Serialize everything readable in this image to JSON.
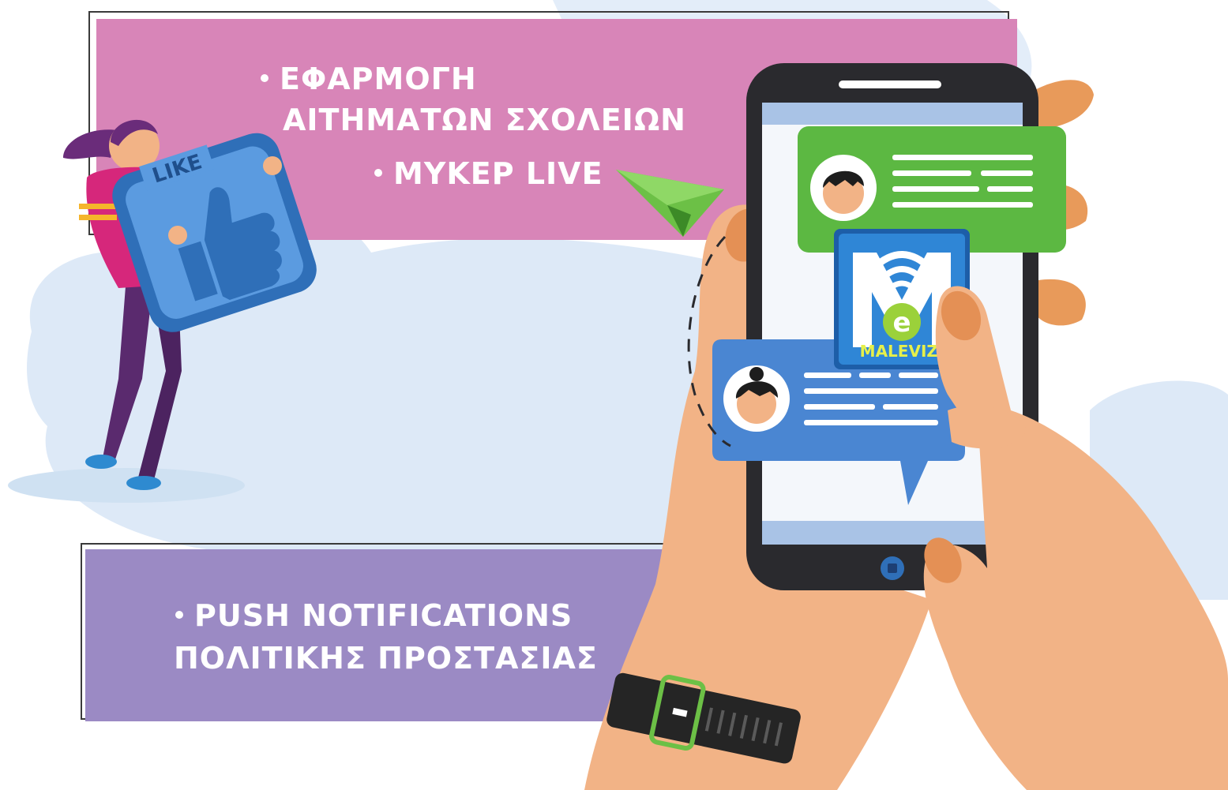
{
  "panel_top": {
    "line1": "ΕΦΑΡΜΟΓΗ",
    "line2": "ΑΙΤΗΜΑΤΩΝ ΣΧΟΛΕΙΩΝ",
    "line3": "MYKEP LIVE"
  },
  "panel_bottom": {
    "line1": "PUSH NOTIFICATIONS",
    "line2": "ΠΟΛΙΤΙΚΗΣ ΠΡΟΣΤΑΣΙΑΣ"
  },
  "like_sign": {
    "label": "LIKE"
  },
  "app_logo": {
    "label": "MALEVIZI",
    "letter": "e"
  },
  "colors": {
    "panel_top": "#d885b8",
    "panel_bottom": "#9b8ac4",
    "sky": "#dde9f7",
    "phone": "#2a2a2e",
    "chat_green": "#5cb842",
    "chat_blue": "#4a86d2",
    "skin": "#f2b386",
    "nail": "#e49055"
  }
}
